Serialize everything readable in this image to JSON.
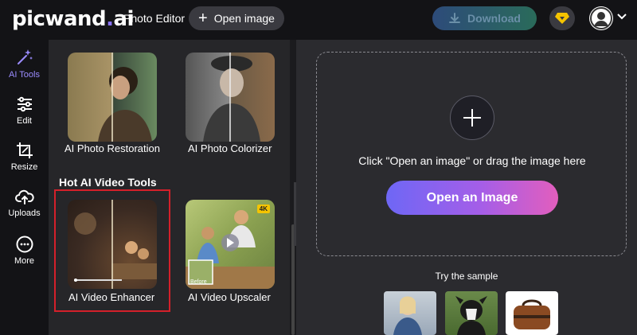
{
  "header": {
    "logo_text": "picwand",
    "logo_ai": "ai",
    "app_name": "Photo Editor",
    "open_image_label": "Open image",
    "download_label": "Download"
  },
  "sidebar": {
    "items": [
      {
        "label": "AI Tools",
        "icon": "sparkle-wand-icon",
        "active": true
      },
      {
        "label": "Edit",
        "icon": "sliders-icon"
      },
      {
        "label": "Resize",
        "icon": "crop-icon"
      },
      {
        "label": "Uploads",
        "icon": "cloud-upload-icon"
      },
      {
        "label": "More",
        "icon": "more-dots-icon"
      }
    ]
  },
  "panel": {
    "tools_top": [
      {
        "label": "AI Photo Restoration"
      },
      {
        "label": "AI Photo Colorizer"
      }
    ],
    "video_section_title": "Hot AI Video Tools",
    "tools_video": [
      {
        "label": "AI Video Enhancer"
      },
      {
        "label": "AI Video Upscaler",
        "badge": "4K",
        "before_label": "Before"
      }
    ]
  },
  "main": {
    "drop_text": "Click \"Open an image\" or drag the image here",
    "open_button_label": "Open an Image",
    "try_sample_label": "Try the sample"
  },
  "colors": {
    "accent": "#9b8cff",
    "header_bg": "#131316",
    "highlight_border": "#d4202a"
  }
}
